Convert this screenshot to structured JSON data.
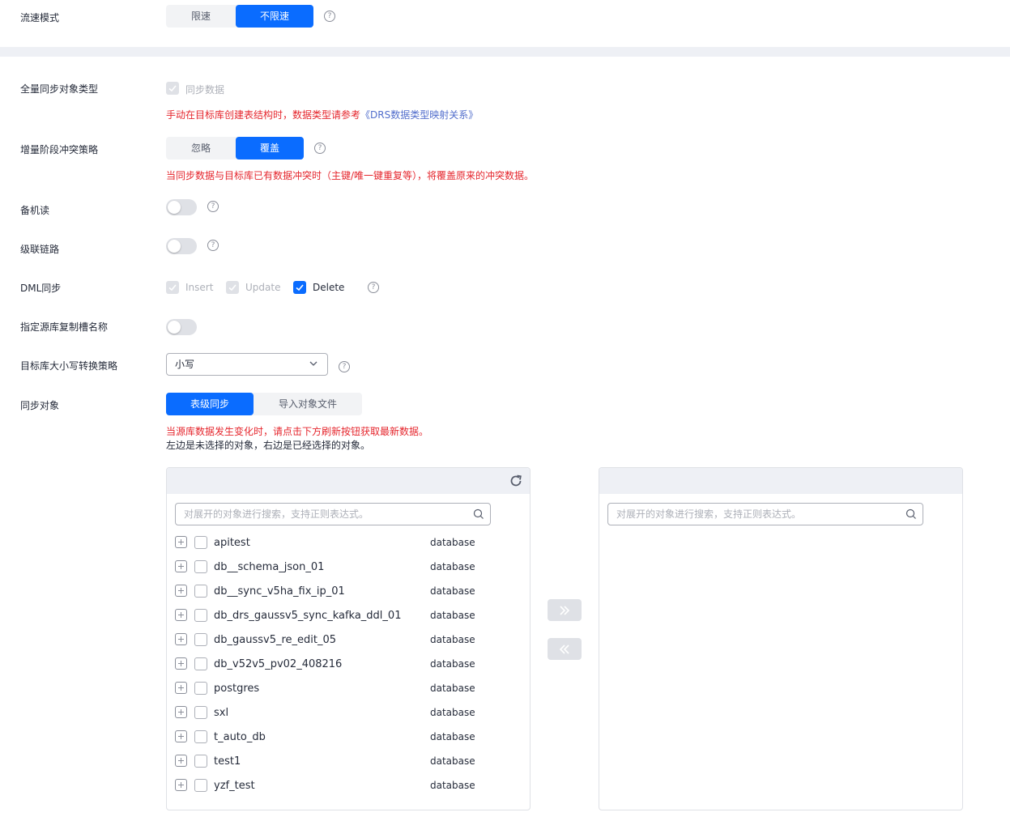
{
  "speed_mode": {
    "label": "流速模式",
    "options": [
      "限速",
      "不限速"
    ],
    "active": 1
  },
  "full_sync_type": {
    "label": "全量同步对象类型",
    "checkbox_label": "同步数据",
    "note_prefix": "手动在目标库创建表结构时，数据类型请参考",
    "note_link": "《DRS数据类型映射关系》"
  },
  "conflict_policy": {
    "label": "增量阶段冲突策略",
    "options": [
      "忽略",
      "覆盖"
    ],
    "active": 1,
    "note": "当同步数据与目标库已有数据冲突时（主键/唯一键重复等），将覆盖原来的冲突数据。"
  },
  "standby_read": {
    "label": "备机读"
  },
  "cascade_link": {
    "label": "级联链路"
  },
  "dml_sync": {
    "label": "DML同步",
    "options": [
      "Insert",
      "Update",
      "Delete"
    ]
  },
  "replication_slot": {
    "label": "指定源库复制槽名称"
  },
  "case_policy": {
    "label": "目标库大小写转换策略",
    "value": "小写"
  },
  "sync_objects": {
    "label": "同步对象",
    "options": [
      "表级同步",
      "导入对象文件"
    ],
    "active": 0,
    "note_red": "当源库数据发生变化时，请点击下方刷新按钮获取最新数据。",
    "note_plain": "左边是未选择的对象，右边是已经选择的对象。"
  },
  "search_placeholder": "对展开的对象进行搜索，支持正则表达式。",
  "objects": [
    {
      "name": "apitest",
      "type": "database"
    },
    {
      "name": "db__schema_json_01",
      "type": "database"
    },
    {
      "name": "db__sync_v5ha_fix_ip_01",
      "type": "database"
    },
    {
      "name": "db_drs_gaussv5_sync_kafka_ddl_01",
      "type": "database"
    },
    {
      "name": "db_gaussv5_re_edit_05",
      "type": "database"
    },
    {
      "name": "db_v52v5_pv02_408216",
      "type": "database"
    },
    {
      "name": "postgres",
      "type": "database"
    },
    {
      "name": "sxl",
      "type": "database"
    },
    {
      "name": "t_auto_db",
      "type": "database"
    },
    {
      "name": "test1",
      "type": "database"
    },
    {
      "name": "yzf_test",
      "type": "database"
    }
  ],
  "colors": {
    "primary": "#0a6cff",
    "danger": "#e5262d",
    "link": "#526ecc",
    "band": "#eef0f5"
  },
  "icons": {
    "help": "question-circle-icon",
    "refresh": "refresh-icon",
    "search": "search-icon",
    "add_all": "double-chevron-right-icon",
    "remove_all": "double-chevron-left-icon"
  }
}
